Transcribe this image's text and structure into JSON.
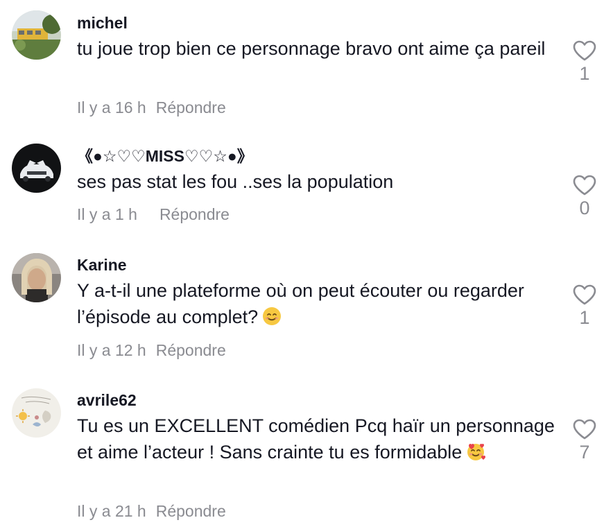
{
  "comments": [
    {
      "username": "michel",
      "text": "tu joue trop bien ce personnage bravo ont aime ça pareil",
      "time": "Il y a 16 h",
      "reply": "Répondre",
      "likes": "1",
      "avatar": "avatar-photo-bus"
    },
    {
      "username": "《●☆♡♡MISS♡♡☆●》",
      "text": "ses pas stat les fou ..ses la population",
      "time": "Il y a 1 h",
      "reply": "Répondre",
      "likes": "0",
      "avatar": "avatar-photo-car"
    },
    {
      "username": "Karine",
      "text": "Y a-t-il une plateforme où on peut écouter ou regarder l’épisode au complet?",
      "emoji": "smiling-face-emoji",
      "time": "Il y a 12 h",
      "reply": "Répondre",
      "likes": "1",
      "avatar": "avatar-photo-woman"
    },
    {
      "username": "avrile62",
      "text": "Tu es un EXCELLENT comédien Pcq haïr un personnage et aime l’acteur ! Sans crainte tu es formidable",
      "emoji": "smiling-face-with-hearts-emoji",
      "time": "Il y a 21 h",
      "reply": "Répondre",
      "likes": "7",
      "avatar": "avatar-illustration-sun-moon"
    }
  ],
  "colors": {
    "text": "#161823",
    "secondary": "#8a8b91",
    "heart_outline": "#8a8b91"
  }
}
